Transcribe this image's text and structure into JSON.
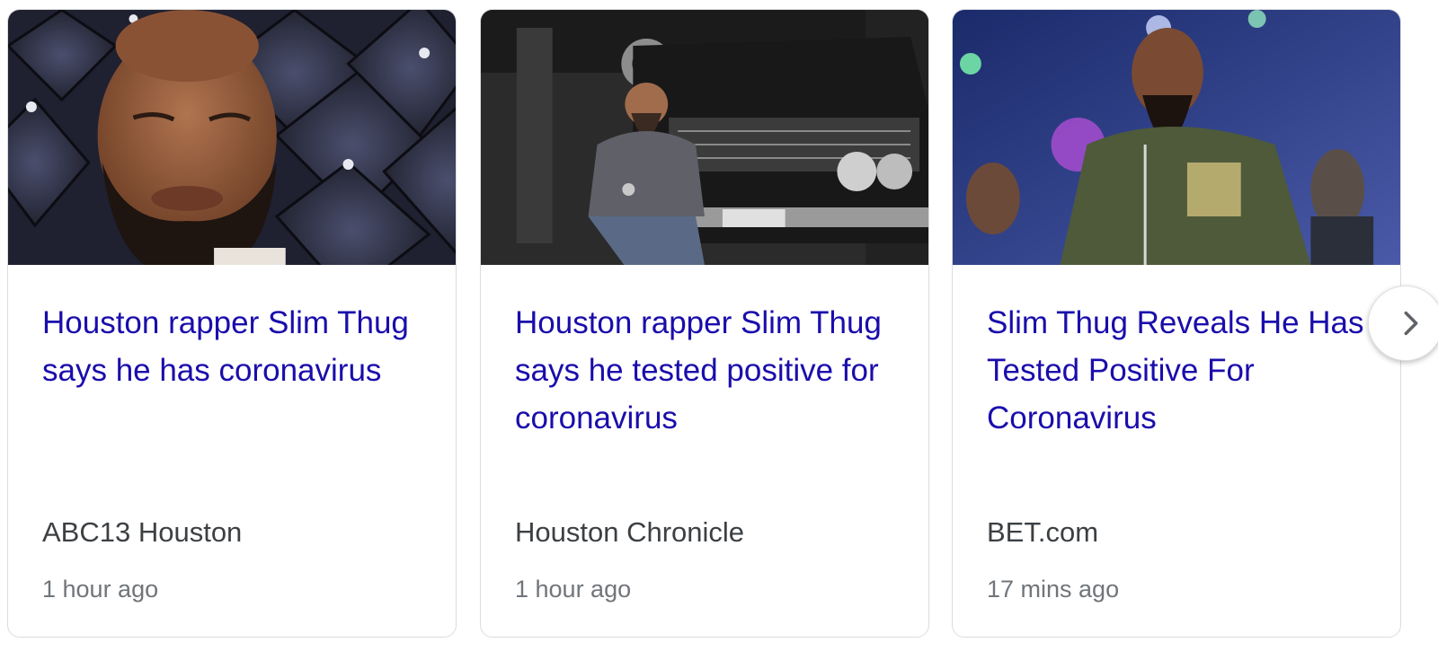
{
  "news_carousel": {
    "cards": [
      {
        "headline": "Houston rapper Slim Thug says he has coronavirus",
        "source": "ABC13 Houston",
        "time": "1 hour ago",
        "thumbnail": "man-portrait-tufted-headboard"
      },
      {
        "headline": "Houston rapper Slim Thug says he tested positive for coronavirus",
        "source": "Houston Chronicle",
        "time": "1 hour ago",
        "thumbnail": "man-crouching-by-vintage-car"
      },
      {
        "headline": "Slim Thug Reveals He Has Tested Positive For Coronavirus",
        "source": "BET.com",
        "time": "17 mins ago",
        "thumbnail": "man-in-green-jacket-at-party"
      }
    ],
    "next_icon": "chevron-right-icon"
  },
  "colors": {
    "headline_link": "#1a0dab",
    "source_text": "#3c4043",
    "time_text": "#70757a",
    "card_border": "#dadce0"
  }
}
